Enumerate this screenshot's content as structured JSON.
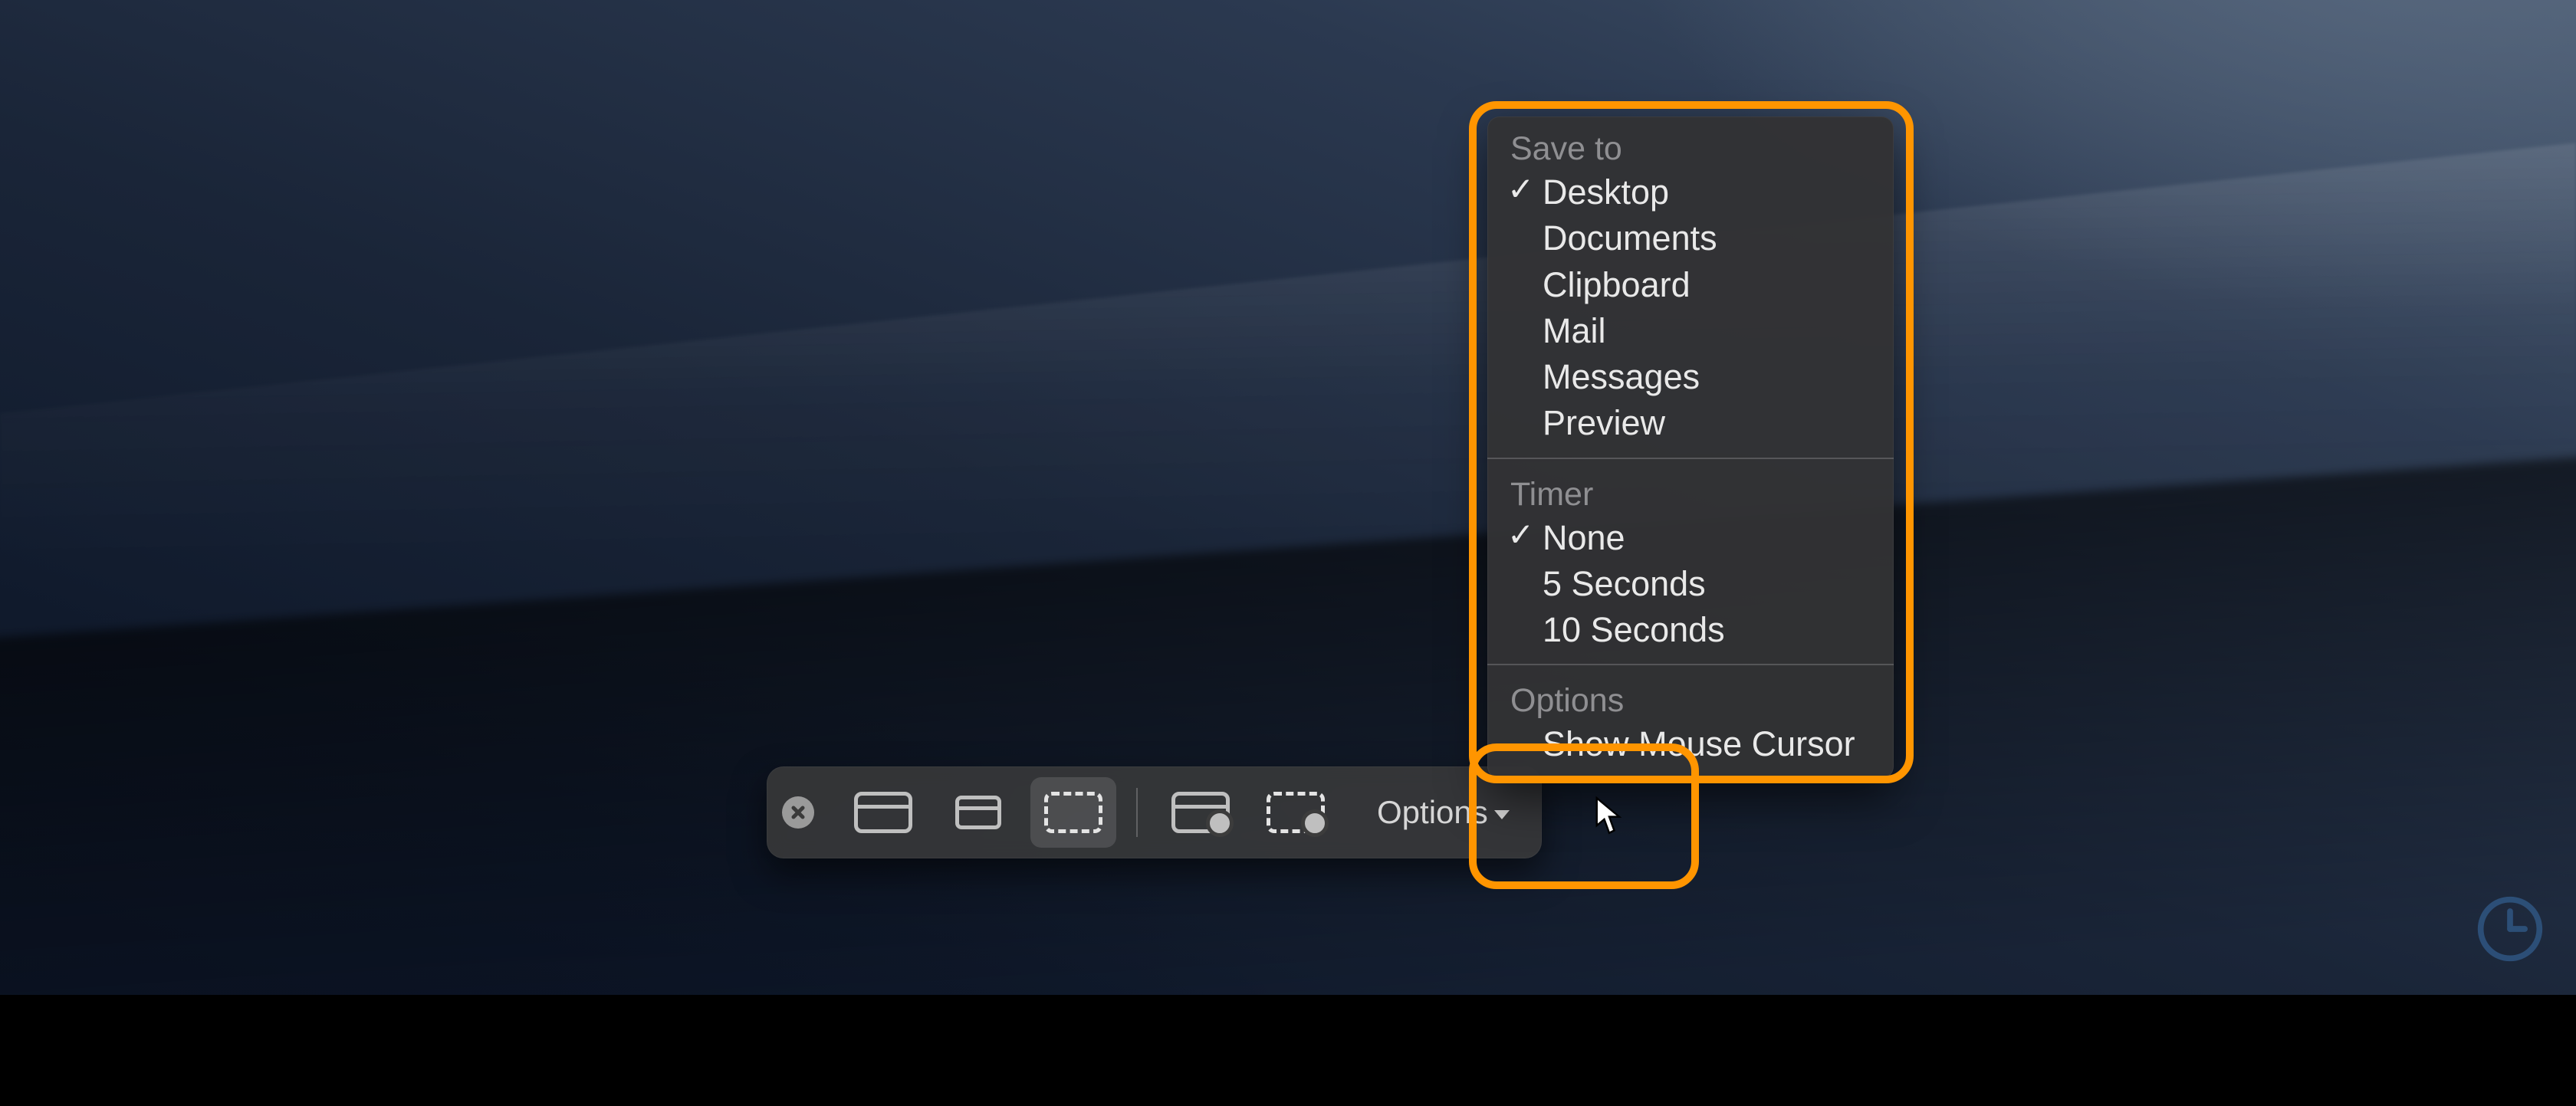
{
  "toolbar": {
    "options_label": "Options"
  },
  "menu": {
    "sections": [
      {
        "title": "Save to",
        "items": [
          {
            "label": "Desktop",
            "checked": true
          },
          {
            "label": "Documents",
            "checked": false
          },
          {
            "label": "Clipboard",
            "checked": false
          },
          {
            "label": "Mail",
            "checked": false
          },
          {
            "label": "Messages",
            "checked": false
          },
          {
            "label": "Preview",
            "checked": false
          }
        ]
      },
      {
        "title": "Timer",
        "items": [
          {
            "label": "None",
            "checked": true
          },
          {
            "label": "5 Seconds",
            "checked": false
          },
          {
            "label": "10 Seconds",
            "checked": false
          }
        ]
      },
      {
        "title": "Options",
        "items": [
          {
            "label": "Show Mouse Cursor",
            "checked": false
          }
        ]
      }
    ]
  }
}
